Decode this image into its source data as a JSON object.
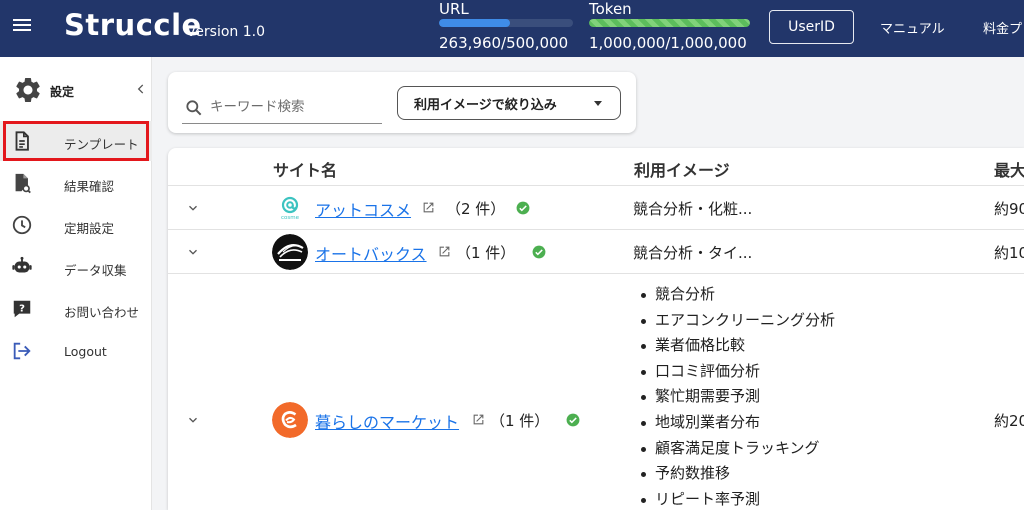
{
  "header": {
    "brand": "Struccle",
    "version": "version 1.0",
    "url_meter": {
      "label": "URL",
      "value": "263,960/500,000",
      "used": 263960,
      "limit": 500000,
      "color": "#3f8ce8"
    },
    "token_meter": {
      "label": "Token",
      "value": "1,000,000/1,000,000",
      "used": 1000000,
      "limit": 1000000,
      "color": "#5cbd5c"
    },
    "user_button": "UserID",
    "manual_link": "マニュアル",
    "pricing_link": "料金プ",
    "background": "#22366a"
  },
  "sidebar": {
    "settings_title": "設定",
    "items": [
      {
        "label": "テンプレート",
        "icon": "document-icon",
        "active": true
      },
      {
        "label": "結果確認",
        "icon": "result-document-icon"
      },
      {
        "label": "定期設定",
        "icon": "clock-icon"
      },
      {
        "label": "データ収集",
        "icon": "robot-icon"
      },
      {
        "label": "お問い合わせ",
        "icon": "help-chat-icon"
      },
      {
        "label": "Logout",
        "icon": "logout-icon"
      }
    ],
    "highlight_color": "#e3171c"
  },
  "search": {
    "placeholder": "キーワード検索",
    "filter_label": "利用イメージで絞り込み"
  },
  "table": {
    "headers": {
      "site": "サイト名",
      "usage": "利用イメージ",
      "max": "最大"
    },
    "rows": [
      {
        "name": "アットコスメ",
        "count": "（2 件）",
        "usage": "競合分析・化粧...",
        "max": "約90",
        "logo": "at-cosme-logo"
      },
      {
        "name": "オートバックス",
        "count": "（1 件）",
        "usage": "競合分析・タイ...",
        "max": "約10",
        "logo": "autobacs-logo"
      },
      {
        "name": "暮らしのマーケット",
        "count": "（1 件）",
        "max": "約20",
        "logo": "kurashi-market-logo",
        "usage_list": [
          "競合分析",
          "エアコンクリーニング分析",
          "業者価格比較",
          "口コミ評価分析",
          "繁忙期需要予測",
          "地域別業者分布",
          "顧客満足度トラッキング",
          "予約数推移",
          "リピート率予測"
        ]
      }
    ],
    "check_color": "#4caf50",
    "link_color": "#1a73e8"
  }
}
